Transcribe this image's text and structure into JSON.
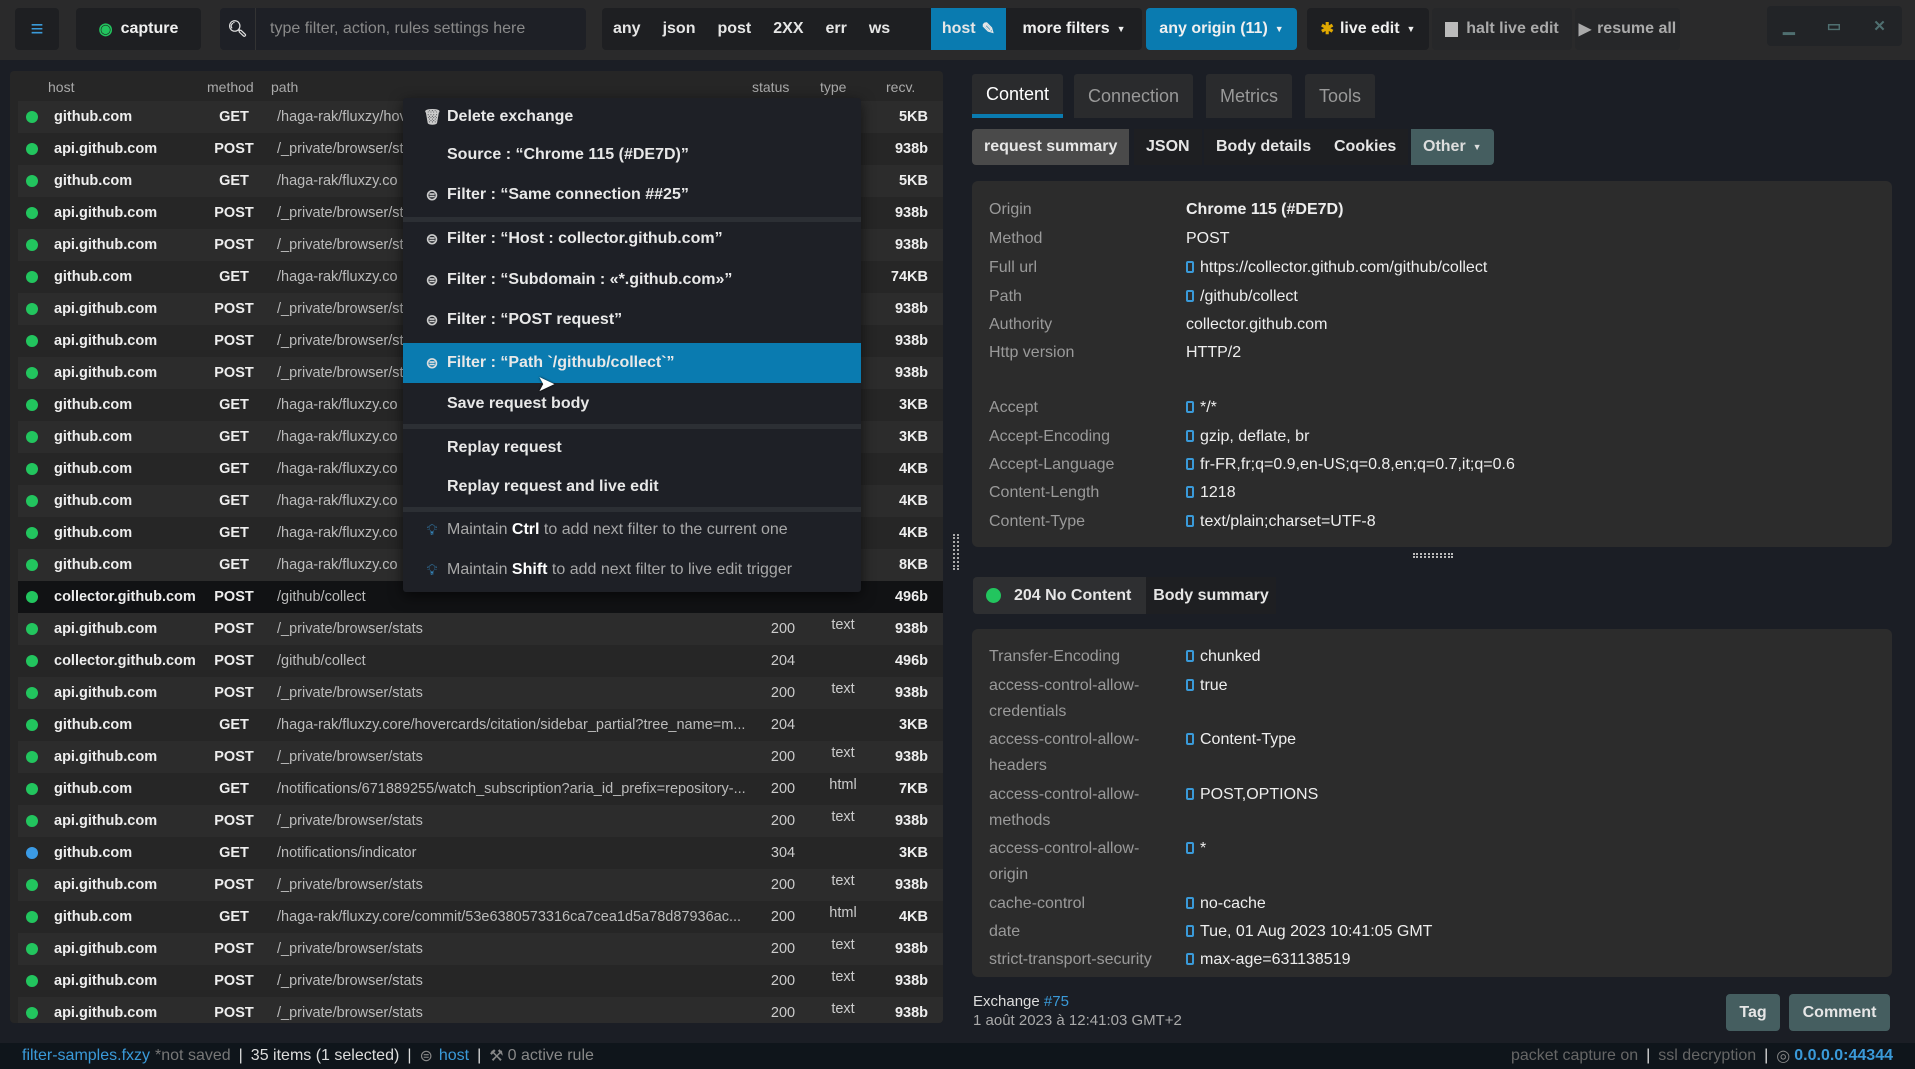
{
  "topbar": {
    "capture": "capture",
    "search_placeholder": "type filter, action, rules settings here",
    "filters": [
      "any",
      "json",
      "post",
      "2XX",
      "err",
      "ws"
    ],
    "host": "host",
    "more_filters": "more filters",
    "any_origin": "any origin (11)",
    "live_edit": "live edit",
    "halt_live_edit": "halt live edit",
    "resume_all": "resume all"
  },
  "table": {
    "headers": {
      "host": "host",
      "method": "method",
      "path": "path",
      "status": "status",
      "type": "type",
      "recv": "recv."
    },
    "rows": [
      [
        "github.com",
        "GET",
        "/haga-rak/fluxzy/hov",
        "",
        "",
        "5KB",
        "green"
      ],
      [
        "api.github.com",
        "POST",
        "/_private/browser/st",
        "",
        "",
        "938b",
        "green"
      ],
      [
        "github.com",
        "GET",
        "/haga-rak/fluxzy.co",
        "",
        "",
        "5KB",
        "green"
      ],
      [
        "api.github.com",
        "POST",
        "/_private/browser/st",
        "",
        "",
        "938b",
        "green"
      ],
      [
        "api.github.com",
        "POST",
        "/_private/browser/st",
        "",
        "",
        "938b",
        "green"
      ],
      [
        "github.com",
        "GET",
        "/haga-rak/fluxzy.co",
        "",
        "",
        "74KB",
        "green"
      ],
      [
        "api.github.com",
        "POST",
        "/_private/browser/st",
        "",
        "",
        "938b",
        "green"
      ],
      [
        "api.github.com",
        "POST",
        "/_private/browser/st",
        "",
        "",
        "938b",
        "green"
      ],
      [
        "api.github.com",
        "POST",
        "/_private/browser/st",
        "",
        "",
        "938b",
        "green"
      ],
      [
        "github.com",
        "GET",
        "/haga-rak/fluxzy.co",
        "",
        "",
        "3KB",
        "green"
      ],
      [
        "github.com",
        "GET",
        "/haga-rak/fluxzy.co",
        "",
        "",
        "3KB",
        "green"
      ],
      [
        "github.com",
        "GET",
        "/haga-rak/fluxzy.co",
        "",
        "",
        "4KB",
        "green"
      ],
      [
        "github.com",
        "GET",
        "/haga-rak/fluxzy.co",
        "",
        "",
        "4KB",
        "green"
      ],
      [
        "github.com",
        "GET",
        "/haga-rak/fluxzy.co",
        "",
        "",
        "4KB",
        "green"
      ],
      [
        "github.com",
        "GET",
        "/haga-rak/fluxzy.co",
        "",
        "",
        "8KB",
        "green"
      ],
      [
        "collector.github.com",
        "POST",
        "/github/collect",
        "",
        "",
        "496b",
        "green"
      ],
      [
        "api.github.com",
        "POST",
        "/_private/browser/stats",
        "200",
        "text",
        "938b",
        "green"
      ],
      [
        "collector.github.com",
        "POST",
        "/github/collect",
        "204",
        "",
        "496b",
        "green"
      ],
      [
        "api.github.com",
        "POST",
        "/_private/browser/stats",
        "200",
        "text",
        "938b",
        "green"
      ],
      [
        "github.com",
        "GET",
        "/haga-rak/fluxzy.core/hovercards/citation/sidebar_partial?tree_name=m...",
        "204",
        "",
        "3KB",
        "green"
      ],
      [
        "api.github.com",
        "POST",
        "/_private/browser/stats",
        "200",
        "text",
        "938b",
        "green"
      ],
      [
        "github.com",
        "GET",
        "/notifications/671889255/watch_subscription?aria_id_prefix=repository-...",
        "200",
        "html",
        "7KB",
        "green"
      ],
      [
        "api.github.com",
        "POST",
        "/_private/browser/stats",
        "200",
        "text",
        "938b",
        "green"
      ],
      [
        "github.com",
        "GET",
        "/notifications/indicator",
        "304",
        "",
        "3KB",
        "blue"
      ],
      [
        "api.github.com",
        "POST",
        "/_private/browser/stats",
        "200",
        "text",
        "938b",
        "green"
      ],
      [
        "github.com",
        "GET",
        "/haga-rak/fluxzy.core/commit/53e6380573316ca7cea1d5a78d87936ac...",
        "200",
        "html",
        "4KB",
        "green"
      ],
      [
        "api.github.com",
        "POST",
        "/_private/browser/stats",
        "200",
        "text",
        "938b",
        "green"
      ],
      [
        "api.github.com",
        "POST",
        "/_private/browser/stats",
        "200",
        "text",
        "938b",
        "green"
      ],
      [
        "api.github.com",
        "POST",
        "/_private/browser/stats",
        "200",
        "text",
        "938b",
        "green"
      ]
    ],
    "selected_index": 15
  },
  "menu": {
    "delete": "Delete exchange",
    "source": "Source : “Chrome 115 (#DE7D)”",
    "same_conn": "Filter : “Same connection ##25”",
    "host": "Filter : “Host : collector.github.com”",
    "subdomain": "Filter : “Subdomain : «*.github.com»”",
    "post": "Filter : “POST request”",
    "path": "Filter : “Path `/github/collect`”",
    "save_body": "Save request body",
    "replay": "Replay request",
    "replay_live": "Replay request and live edit",
    "hint1": {
      "a": "Maintain ",
      "b": "Ctrl",
      "c": " to add next filter to the current one"
    },
    "hint2": {
      "a": "Maintain ",
      "b": "Shift",
      "c": " to add next filter to live edit trigger"
    }
  },
  "detail": {
    "tabs": [
      "Content",
      "Connection",
      "Metrics",
      "Tools"
    ],
    "subtabs": [
      "request summary",
      "JSON",
      "Body details",
      "Cookies",
      "Other"
    ],
    "request": [
      [
        "Origin",
        "Chrome 115 (#DE7D)",
        false
      ],
      [
        "Method",
        "POST",
        false
      ],
      [
        "Full url",
        "https://collector.github.com/github/collect",
        true
      ],
      [
        "Path",
        "/github/collect",
        true
      ],
      [
        "Authority",
        "collector.github.com",
        false
      ],
      [
        "Http version",
        "HTTP/2",
        false
      ],
      [
        "Accept",
        "*/*",
        true
      ],
      [
        "Accept-Encoding",
        "gzip, deflate, br",
        true
      ],
      [
        "Accept-Language",
        "fr-FR,fr;q=0.9,en-US;q=0.8,en;q=0.7,it;q=0.6",
        true
      ],
      [
        "Content-Length",
        "1218",
        true
      ],
      [
        "Content-Type",
        "text/plain;charset=UTF-8",
        true
      ]
    ],
    "response_status": "204 No Content",
    "body_summary": "Body summary",
    "response": [
      [
        "Transfer-Encoding",
        "chunked"
      ],
      [
        "access-control-allow-credentials",
        "true"
      ],
      [
        "access-control-allow-headers",
        "Content-Type"
      ],
      [
        "access-control-allow-methods",
        "POST,OPTIONS"
      ],
      [
        "access-control-allow-origin",
        "*"
      ],
      [
        "cache-control",
        "no-cache"
      ],
      [
        "date",
        "Tue, 01 Aug 2023 10:41:05 GMT"
      ],
      [
        "strict-transport-security",
        "max-age=631138519"
      ]
    ],
    "exchange_label": "Exchange",
    "exchange_id": "#75",
    "exchange_date": "1 août 2023 à 12:41:03 GMT+2",
    "tag": "Tag",
    "comment": "Comment"
  },
  "status": {
    "file": "filter-samples.fxzy",
    "not_saved": "*not saved",
    "items": "35 items (1 selected)",
    "filter": "host",
    "rules": "0 active rule",
    "capture": "packet capture on",
    "ssl": "ssl decryption",
    "address": "0.0.0.0:44344"
  },
  "colors": {
    "accent": "#0a7bb0",
    "ok": "#22c55e",
    "info": "#3b9be6"
  }
}
